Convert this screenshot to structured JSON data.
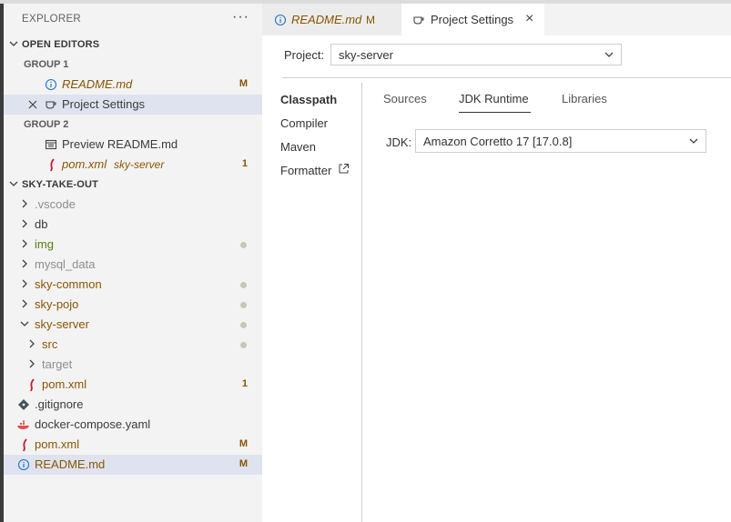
{
  "explorer": {
    "title": "EXPLORER",
    "more": "···",
    "open_editors": {
      "title": "OPEN EDITORS",
      "group1": {
        "title": "GROUP 1",
        "items": [
          {
            "label": "README.md",
            "badge": "M"
          },
          {
            "label": "Project Settings"
          }
        ]
      },
      "group2": {
        "title": "GROUP 2",
        "items": [
          {
            "label": "Preview README.md"
          },
          {
            "label": "pom.xml",
            "desc": "sky-server",
            "badge": "1"
          }
        ]
      }
    },
    "project": {
      "title": "SKY-TAKE-OUT",
      "items": [
        {
          "label": ".vscode"
        },
        {
          "label": "db"
        },
        {
          "label": "img"
        },
        {
          "label": "mysql_data"
        },
        {
          "label": "sky-common"
        },
        {
          "label": "sky-pojo"
        },
        {
          "label": "sky-server"
        },
        {
          "label": "src"
        },
        {
          "label": "target"
        },
        {
          "label": "pom.xml",
          "badge": "1"
        },
        {
          "label": ".gitignore"
        },
        {
          "label": "docker-compose.yaml"
        },
        {
          "label": "pom.xml",
          "badge": "M"
        },
        {
          "label": "README.md",
          "badge": "M"
        }
      ]
    }
  },
  "tabs": [
    {
      "label": "README.md",
      "badge": "M"
    },
    {
      "label": "Project Settings",
      "close": "×"
    }
  ],
  "settings": {
    "project_label": "Project:",
    "project_value": "sky-server",
    "nav": [
      "Classpath",
      "Compiler",
      "Maven",
      "Formatter"
    ],
    "subtabs": [
      "Sources",
      "JDK Runtime",
      "Libraries"
    ],
    "jdk_label": "JDK:",
    "jdk_value": "Amazon Corretto 17 [17.0.8]"
  },
  "colors": {
    "modified": "#895503",
    "untracked_green": "#587c0c",
    "selection": "#dfe3ef",
    "sidebar_bg": "#f3f3f3"
  }
}
